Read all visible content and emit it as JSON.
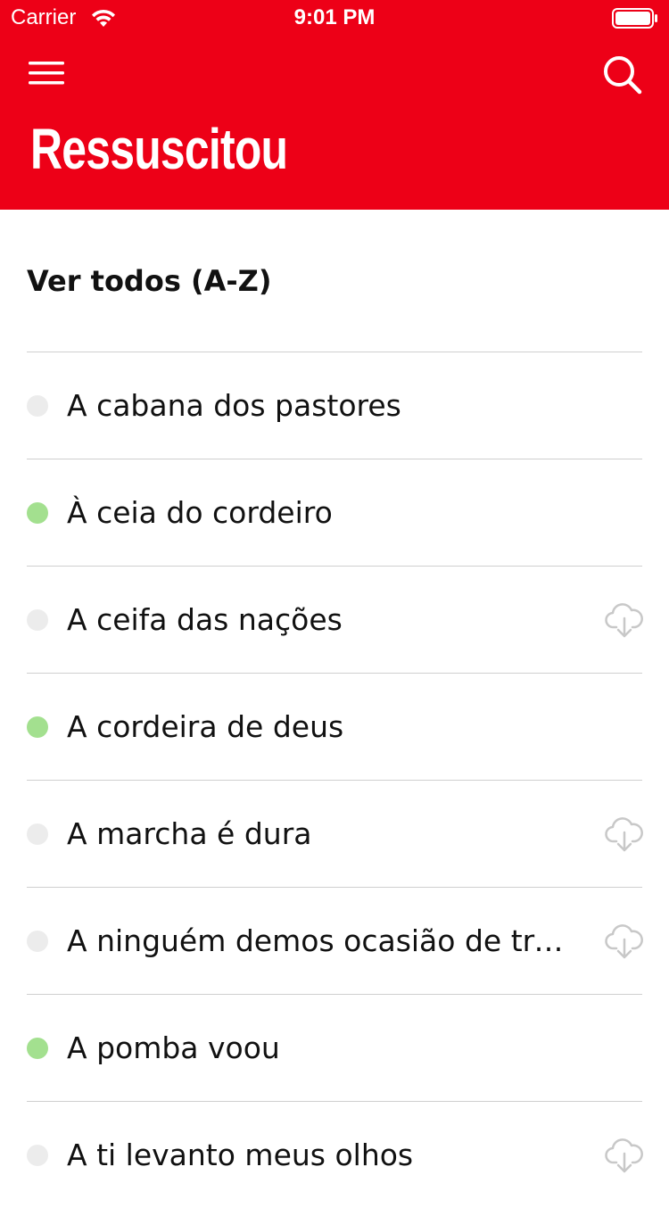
{
  "status_bar": {
    "carrier": "Carrier",
    "time": "9:01 PM"
  },
  "header": {
    "title": "Ressuscitou",
    "background_color": "#ED0017",
    "menu_icon": "hamburger-menu-icon",
    "search_icon": "search-icon"
  },
  "section": {
    "title": "Ver todos (A-Z)"
  },
  "songs": [
    {
      "title": "A cabana dos pastores",
      "status": "gray",
      "download": false
    },
    {
      "title": "À ceia do cordeiro",
      "status": "green",
      "download": false
    },
    {
      "title": "A ceifa das nações",
      "status": "gray",
      "download": true
    },
    {
      "title": "A cordeira de deus",
      "status": "green",
      "download": false
    },
    {
      "title": "A marcha é dura",
      "status": "gray",
      "download": true
    },
    {
      "title": "A ninguém demos ocasião de tropeço",
      "status": "gray",
      "download": true
    },
    {
      "title": "A pomba voou",
      "status": "green",
      "download": false
    },
    {
      "title": "A ti levanto meus olhos",
      "status": "gray",
      "download": true
    }
  ],
  "colors": {
    "accent": "#ED0017",
    "status_green": "#a3e08f",
    "status_gray": "#ececec",
    "download_icon": "#c8c8c8"
  }
}
